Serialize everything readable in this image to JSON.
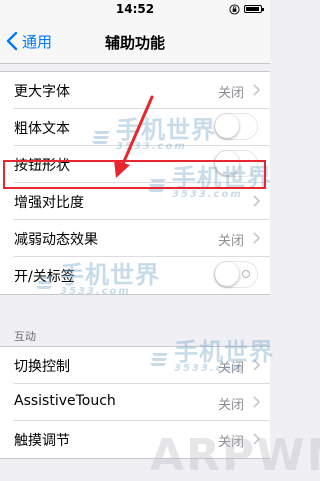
{
  "status_bar": {
    "time": "14:52",
    "lock_icon": "rotation-lock-icon",
    "battery_icon": "battery-icon"
  },
  "nav": {
    "back_label": "通用",
    "back_icon": "chevron-left-icon",
    "title": "辅助功能"
  },
  "group1": {
    "rows": [
      {
        "label": "更大字体",
        "value": "关闭",
        "accessory": "chevron"
      },
      {
        "label": "粗体文本",
        "accessory": "toggle",
        "state": "off"
      },
      {
        "label": "按钮形状",
        "accessory": "toggle",
        "state": "off"
      },
      {
        "label": "增强对比度",
        "accessory": "chevron"
      },
      {
        "label": "减弱动态效果",
        "value": "关闭",
        "accessory": "chevron"
      },
      {
        "label": "开/关标签",
        "accessory": "toggle",
        "state": "off"
      }
    ]
  },
  "section2": {
    "header": "互动",
    "rows": [
      {
        "label": "切换控制",
        "value": "关闭",
        "accessory": "chevron"
      },
      {
        "label": "AssistiveTouch",
        "value": "关闭",
        "accessory": "chevron"
      },
      {
        "label": "触摸调节",
        "value": "关闭",
        "accessory": "chevron"
      }
    ]
  },
  "watermarks": {
    "text": "手机世界",
    "sub": "3533.com",
    "corner": "ARPWN"
  },
  "annotation": {
    "color": "#e8262d"
  },
  "colors": {
    "accent": "#007aff",
    "background": "#efeff4",
    "secondary_text": "#8e8e93"
  }
}
